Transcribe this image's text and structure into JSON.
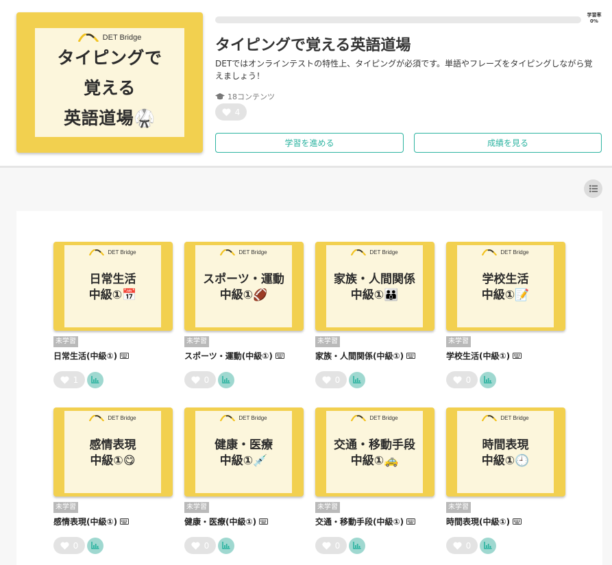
{
  "course": {
    "thumb_brand": "DET Bridge",
    "thumb_title_lines": [
      "タイピングで",
      "覚える",
      "英語道場🥋"
    ],
    "title": "タイピングで覚える英語道場",
    "description": "DETではオンラインテストの特性上、タイピングが必須です。単語やフレーズをタイピングしながら覚えましょう！",
    "contents_count": "18コンテンツ",
    "likes": "4",
    "progress_label": "学習率",
    "progress_value": "0%",
    "progress_fraction": 0,
    "learn_button": "学習を進める",
    "results_button": "成績を見る"
  },
  "colors": {
    "accent": "#2bb3a0",
    "thumb_yellow": "#f2d04f",
    "thumb_cream": "#fcf6dc"
  },
  "cards": [
    {
      "brand": "DET Bridge",
      "thumb_line1": "日常生活",
      "thumb_line2": "中級①📅",
      "status": "未学習",
      "name": "日常生活(中級①)",
      "likes": "1"
    },
    {
      "brand": "DET Bridge",
      "thumb_line1": "スポーツ・運動",
      "thumb_line2": "中級①🏈",
      "status": "未学習",
      "name": "スポーツ・運動(中級①)",
      "likes": "0"
    },
    {
      "brand": "DET Bridge",
      "thumb_line1": "家族・人間関係",
      "thumb_line2": "中級①👪",
      "status": "未学習",
      "name": "家族・人間関係(中級①)",
      "likes": "0"
    },
    {
      "brand": "DET Bridge",
      "thumb_line1": "学校生活",
      "thumb_line2": "中級①📝",
      "status": "未学習",
      "name": "学校生活(中級①)",
      "likes": "0"
    },
    {
      "brand": "DET Bridge",
      "thumb_line1": "感情表現",
      "thumb_line2": "中級①😋",
      "status": "未学習",
      "name": "感情表現(中級①)",
      "likes": "0"
    },
    {
      "brand": "DET Bridge",
      "thumb_line1": "健康・医療",
      "thumb_line2": "中級①💉",
      "status": "未学習",
      "name": "健康・医療(中級①)",
      "likes": "0"
    },
    {
      "brand": "DET Bridge",
      "thumb_line1": "交通・移動手段",
      "thumb_line2": "中級①🚕",
      "status": "未学習",
      "name": "交通・移動手段(中級①)",
      "likes": "0"
    },
    {
      "brand": "DET Bridge",
      "thumb_line1": "時間表現",
      "thumb_line2": "中級①🕘",
      "status": "未学習",
      "name": "時間表現(中級①)",
      "likes": "0"
    }
  ]
}
